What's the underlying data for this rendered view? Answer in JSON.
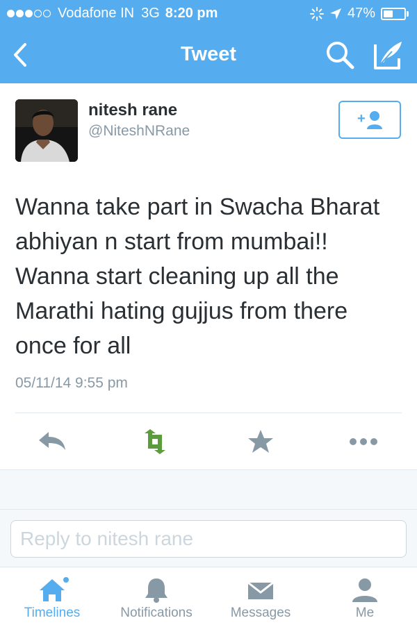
{
  "status_bar": {
    "carrier": "Vodafone IN",
    "network": "3G",
    "time": "8:20 pm",
    "battery": "47%",
    "battery_level": 0.47,
    "signal_bars": 3,
    "signal_total": 5
  },
  "nav": {
    "title": "Tweet"
  },
  "tweet": {
    "author_name": "nitesh rane",
    "author_handle": "@NiteshNRane",
    "text": "Wanna take part in Swacha Bharat abhiyan n start from mumbai!! Wanna start cleaning up all the Marathi hating gujjus from there once for all",
    "timestamp": "05/11/14 9:55 pm"
  },
  "reply": {
    "placeholder": "Reply to nitesh rane"
  },
  "tabs": [
    {
      "label": "Timelines",
      "icon": "home-icon",
      "active": true
    },
    {
      "label": "Notifications",
      "icon": "bell-icon",
      "active": false
    },
    {
      "label": "Messages",
      "icon": "envelope-icon",
      "active": false
    },
    {
      "label": "Me",
      "icon": "person-icon",
      "active": false
    }
  ],
  "colors": {
    "brand": "#55acee",
    "retweet": "#5c9c3c",
    "icon_gray": "#8899a6",
    "text": "#292f33"
  }
}
